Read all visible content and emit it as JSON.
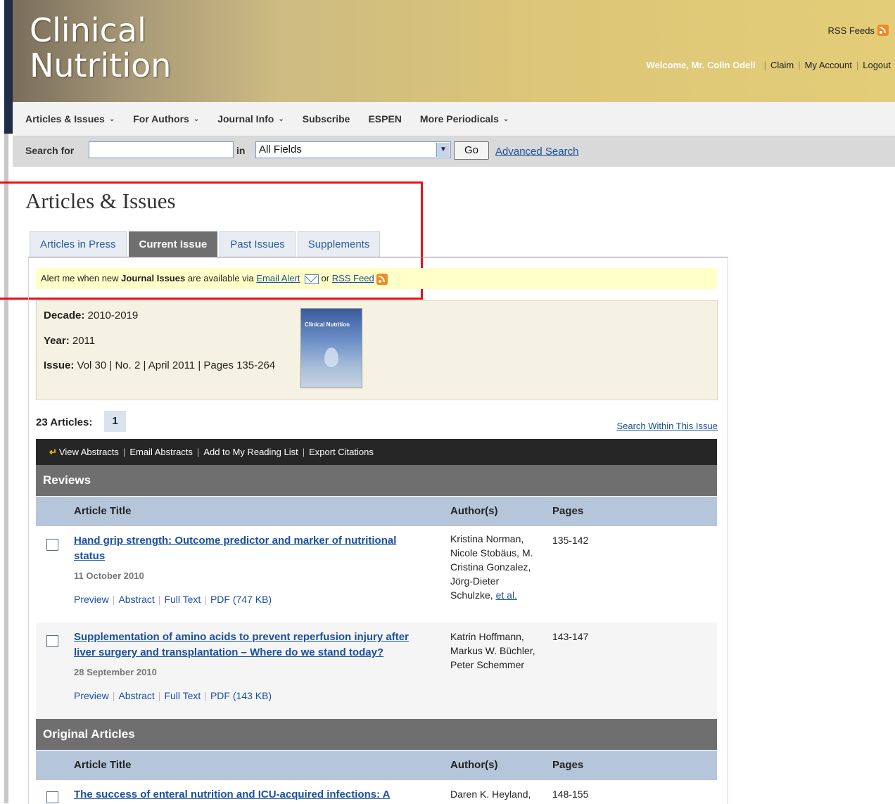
{
  "header": {
    "logo_line1": "Clinical",
    "logo_line2": "Nutrition",
    "rss_feeds": "RSS Feeds",
    "welcome": "Welcome, Mr. Colin Odell",
    "claim": "Claim",
    "my_account": "My Account",
    "logout": "Logout"
  },
  "nav": {
    "items": [
      "Articles & Issues",
      "For Authors",
      "Journal Info",
      "Subscribe",
      "ESPEN",
      "More Periodicals"
    ]
  },
  "search": {
    "label": "Search for",
    "value": "",
    "in_label": "in",
    "selected_field": "All Fields",
    "go": "Go",
    "advanced": "Advanced Search"
  },
  "page_title": "Articles & Issues",
  "tabs": [
    "Articles in Press",
    "Current Issue",
    "Past Issues",
    "Supplements"
  ],
  "active_tab": "Current Issue",
  "alert": {
    "prefix": "Alert me when new ",
    "bold": "Journal Issues",
    "middle": " are available via ",
    "email_alert": "Email Alert",
    "or": "or",
    "rss_feed": "RSS Feed"
  },
  "issue": {
    "decade_label": "Decade:",
    "decade": "2010-2019",
    "year_label": "Year:",
    "year": "2011",
    "issue_label": "Issue:",
    "issue": "Vol 30 | No. 2 | April 2011 | Pages 135-264",
    "cover_title": "Clinical Nutrition"
  },
  "articles_count": "23 Articles:",
  "page_number": "1",
  "search_within": "Search Within This Issue",
  "toolbar": [
    "View Abstracts",
    "Email Abstracts",
    "Add to My Reading List",
    "Export Citations"
  ],
  "columns": {
    "title": "Article Title",
    "authors": "Author(s)",
    "pages": "Pages"
  },
  "sections": [
    {
      "name": "Reviews",
      "articles": [
        {
          "title_line1": "Hand grip strength: Outcome predictor and marker of nutritional",
          "title_line2": "status",
          "date": "11 October 2010",
          "links": [
            "Preview",
            "Abstract",
            "Full Text",
            "PDF (747 KB)"
          ],
          "authors": [
            "Kristina Norman,",
            "Nicole Stobäus, M.",
            "Cristina Gonzalez,",
            "Jörg-Dieter"
          ],
          "authors_last": "Schulzke,",
          "et_al": "et al.",
          "pages": "135-142"
        },
        {
          "title_line1": "Supplementation of amino acids to prevent reperfusion injury after",
          "title_line2": "liver surgery and transplantation – Where do we stand today?",
          "date": "28 September 2010",
          "links": [
            "Preview",
            "Abstract",
            "Full Text",
            "PDF (143 KB)"
          ],
          "authors": [
            "Katrin Hoffmann,",
            "Markus W. Büchler,",
            "Peter Schemmer"
          ],
          "pages": "143-147"
        }
      ]
    },
    {
      "name": "Original Articles",
      "articles": [
        {
          "title_line1": "The success of enteral nutrition and ICU-acquired infections: A",
          "authors": [
            "Daren K. Heyland,"
          ],
          "pages": "148-155"
        }
      ]
    }
  ]
}
